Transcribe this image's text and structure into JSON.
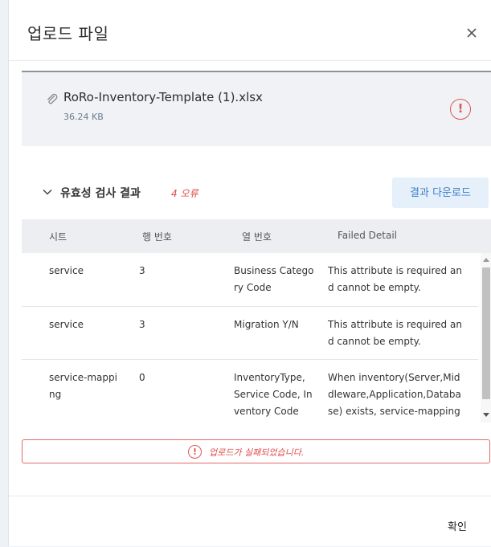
{
  "dialog": {
    "title": "업로드 파일",
    "close_icon": "close-icon"
  },
  "file": {
    "name": "RoRo-Inventory-Template (1).xlsx",
    "size": "36.24 KB",
    "icon": "paperclip-icon",
    "status_icon": "error-circle-icon",
    "status_color": "#e05555"
  },
  "validation": {
    "title": "유효성 검사 결과",
    "error_count": "4 오류",
    "download_label": "결과 다운로드",
    "columns": [
      "시트",
      "행 번호",
      "열 번호",
      "Failed Detail"
    ],
    "rows": [
      {
        "sheet": "service",
        "row": "3",
        "column": "Business Category Code",
        "detail": "This attribute is required and cannot be empty."
      },
      {
        "sheet": "service",
        "row": "3",
        "column": "Migration Y/N",
        "detail": "This attribute is required and cannot be empty."
      },
      {
        "sheet": "service-mapping",
        "row": "0",
        "column": "InventoryType, Service Code, Inventory Code",
        "detail": "When inventory(Server,Middleware,Application,Database) exists, service-mapping d"
      }
    ]
  },
  "alert": {
    "message": "업로드가 실패되었습니다.",
    "color": "#e04b4b"
  },
  "footer": {
    "confirm_label": "확인"
  },
  "colors": {
    "accent": "#3f7ec9",
    "error": "#e04b4b",
    "header_bg": "#eceef2"
  }
}
